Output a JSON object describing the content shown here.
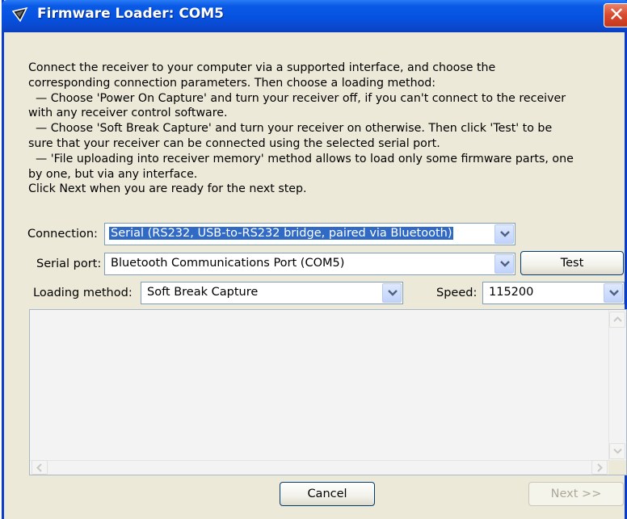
{
  "window": {
    "title": "Firmware Loader: COM5",
    "close_glyph": "✕",
    "icon": "antenna-icon"
  },
  "description": [
    "Connect the receiver to your computer via a supported interface, and choose the",
    "corresponding connection parameters. Then choose a loading method:",
    "  — Choose 'Power On Capture' and turn your receiver off, if you can't connect to the receiver",
    "with any receiver control software.",
    "  — Choose 'Soft Break Capture' and turn your receiver on otherwise. Then click 'Test' to be",
    "sure that your receiver can be connected using the selected serial port.",
    "  — 'File uploading into receiver memory' method allows to load only some firmware parts, one",
    "by one, but via any interface.",
    "Click Next when you are ready for the next step."
  ],
  "form": {
    "connection_label": "Connection:",
    "connection_value": "Serial (RS232, USB-to-RS232 bridge, paired via Bluetooth)",
    "serial_port_label": "Serial port:",
    "serial_port_value": "Bluetooth Communications Port (COM5)",
    "test_button": "Test",
    "loading_method_label": "Loading method:",
    "loading_method_value": "Soft Break Capture",
    "speed_label": "Speed:",
    "speed_value": "115200"
  },
  "log": {
    "content": ""
  },
  "footer": {
    "cancel_button": "Cancel",
    "next_button": "Next >>"
  },
  "colors": {
    "titlebar": "#0a5ae6",
    "selection": "#316ac5",
    "close": "#d8492d"
  }
}
